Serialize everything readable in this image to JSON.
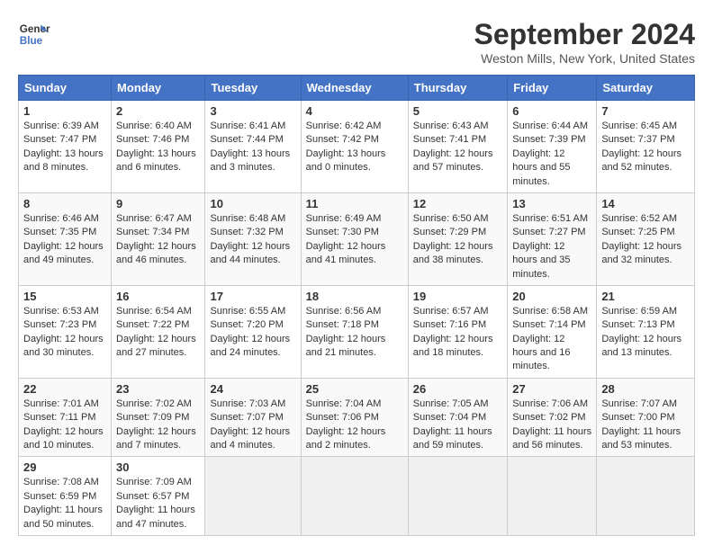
{
  "header": {
    "logo_line1": "General",
    "logo_line2": "Blue",
    "month": "September 2024",
    "location": "Weston Mills, New York, United States"
  },
  "weekdays": [
    "Sunday",
    "Monday",
    "Tuesday",
    "Wednesday",
    "Thursday",
    "Friday",
    "Saturday"
  ],
  "weeks": [
    [
      {
        "day": "1",
        "sunrise": "6:39 AM",
        "sunset": "7:47 PM",
        "daylight": "13 hours and 8 minutes."
      },
      {
        "day": "2",
        "sunrise": "6:40 AM",
        "sunset": "7:46 PM",
        "daylight": "13 hours and 6 minutes."
      },
      {
        "day": "3",
        "sunrise": "6:41 AM",
        "sunset": "7:44 PM",
        "daylight": "13 hours and 3 minutes."
      },
      {
        "day": "4",
        "sunrise": "6:42 AM",
        "sunset": "7:42 PM",
        "daylight": "13 hours and 0 minutes."
      },
      {
        "day": "5",
        "sunrise": "6:43 AM",
        "sunset": "7:41 PM",
        "daylight": "12 hours and 57 minutes."
      },
      {
        "day": "6",
        "sunrise": "6:44 AM",
        "sunset": "7:39 PM",
        "daylight": "12 hours and 55 minutes."
      },
      {
        "day": "7",
        "sunrise": "6:45 AM",
        "sunset": "7:37 PM",
        "daylight": "12 hours and 52 minutes."
      }
    ],
    [
      {
        "day": "8",
        "sunrise": "6:46 AM",
        "sunset": "7:35 PM",
        "daylight": "12 hours and 49 minutes."
      },
      {
        "day": "9",
        "sunrise": "6:47 AM",
        "sunset": "7:34 PM",
        "daylight": "12 hours and 46 minutes."
      },
      {
        "day": "10",
        "sunrise": "6:48 AM",
        "sunset": "7:32 PM",
        "daylight": "12 hours and 44 minutes."
      },
      {
        "day": "11",
        "sunrise": "6:49 AM",
        "sunset": "7:30 PM",
        "daylight": "12 hours and 41 minutes."
      },
      {
        "day": "12",
        "sunrise": "6:50 AM",
        "sunset": "7:29 PM",
        "daylight": "12 hours and 38 minutes."
      },
      {
        "day": "13",
        "sunrise": "6:51 AM",
        "sunset": "7:27 PM",
        "daylight": "12 hours and 35 minutes."
      },
      {
        "day": "14",
        "sunrise": "6:52 AM",
        "sunset": "7:25 PM",
        "daylight": "12 hours and 32 minutes."
      }
    ],
    [
      {
        "day": "15",
        "sunrise": "6:53 AM",
        "sunset": "7:23 PM",
        "daylight": "12 hours and 30 minutes."
      },
      {
        "day": "16",
        "sunrise": "6:54 AM",
        "sunset": "7:22 PM",
        "daylight": "12 hours and 27 minutes."
      },
      {
        "day": "17",
        "sunrise": "6:55 AM",
        "sunset": "7:20 PM",
        "daylight": "12 hours and 24 minutes."
      },
      {
        "day": "18",
        "sunrise": "6:56 AM",
        "sunset": "7:18 PM",
        "daylight": "12 hours and 21 minutes."
      },
      {
        "day": "19",
        "sunrise": "6:57 AM",
        "sunset": "7:16 PM",
        "daylight": "12 hours and 18 minutes."
      },
      {
        "day": "20",
        "sunrise": "6:58 AM",
        "sunset": "7:14 PM",
        "daylight": "12 hours and 16 minutes."
      },
      {
        "day": "21",
        "sunrise": "6:59 AM",
        "sunset": "7:13 PM",
        "daylight": "12 hours and 13 minutes."
      }
    ],
    [
      {
        "day": "22",
        "sunrise": "7:01 AM",
        "sunset": "7:11 PM",
        "daylight": "12 hours and 10 minutes."
      },
      {
        "day": "23",
        "sunrise": "7:02 AM",
        "sunset": "7:09 PM",
        "daylight": "12 hours and 7 minutes."
      },
      {
        "day": "24",
        "sunrise": "7:03 AM",
        "sunset": "7:07 PM",
        "daylight": "12 hours and 4 minutes."
      },
      {
        "day": "25",
        "sunrise": "7:04 AM",
        "sunset": "7:06 PM",
        "daylight": "12 hours and 2 minutes."
      },
      {
        "day": "26",
        "sunrise": "7:05 AM",
        "sunset": "7:04 PM",
        "daylight": "11 hours and 59 minutes."
      },
      {
        "day": "27",
        "sunrise": "7:06 AM",
        "sunset": "7:02 PM",
        "daylight": "11 hours and 56 minutes."
      },
      {
        "day": "28",
        "sunrise": "7:07 AM",
        "sunset": "7:00 PM",
        "daylight": "11 hours and 53 minutes."
      }
    ],
    [
      {
        "day": "29",
        "sunrise": "7:08 AM",
        "sunset": "6:59 PM",
        "daylight": "11 hours and 50 minutes."
      },
      {
        "day": "30",
        "sunrise": "7:09 AM",
        "sunset": "6:57 PM",
        "daylight": "11 hours and 47 minutes."
      },
      null,
      null,
      null,
      null,
      null
    ]
  ]
}
